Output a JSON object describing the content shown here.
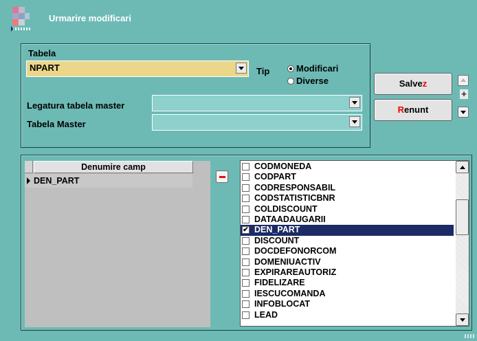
{
  "window": {
    "title": "Urmarire modificari"
  },
  "form": {
    "tabela_label": "Tabela",
    "tabela_value": "NPART",
    "tip_label": "Tip",
    "tip_options": [
      "Modificari",
      "Diverse"
    ],
    "tip_selected": "Modificari",
    "legatura_label": "Legatura tabela master",
    "legatura_value": "",
    "tabela_master_label": "Tabela Master",
    "tabela_master_value": ""
  },
  "buttons": {
    "save_pre": "Salve",
    "save_key": "z",
    "cancel_key": "R",
    "cancel_post": "enunt",
    "plus": "+",
    "minus": "-"
  },
  "grid": {
    "header": "Denumire camp",
    "rows": [
      "DEN_PART"
    ]
  },
  "fields": [
    {
      "name": "CODMONEDA",
      "checked": false
    },
    {
      "name": "CODPART",
      "checked": false
    },
    {
      "name": "CODRESPONSABIL",
      "checked": false
    },
    {
      "name": "CODSTATISTICBNR",
      "checked": false
    },
    {
      "name": "COLDISCOUNT",
      "checked": false
    },
    {
      "name": "DATAADAUGARII",
      "checked": false
    },
    {
      "name": "DEN_PART",
      "checked": true
    },
    {
      "name": "DISCOUNT",
      "checked": false
    },
    {
      "name": "DOCDEFONORCOM",
      "checked": false
    },
    {
      "name": "DOMENIUACTIV",
      "checked": false
    },
    {
      "name": "EXPIRAREAUTORIZ",
      "checked": false
    },
    {
      "name": "FIDELIZARE",
      "checked": false
    },
    {
      "name": "IESCUCOMANDA",
      "checked": false
    },
    {
      "name": "INFOBLOCAT",
      "checked": false
    },
    {
      "name": "LEAD",
      "checked": false
    }
  ],
  "selected_field": "DEN_PART",
  "colors": {
    "background": "#6dbab5",
    "selection": "#1c2a66",
    "accent_red": "#ee0000",
    "combo_yellow": "#ecd68a"
  }
}
